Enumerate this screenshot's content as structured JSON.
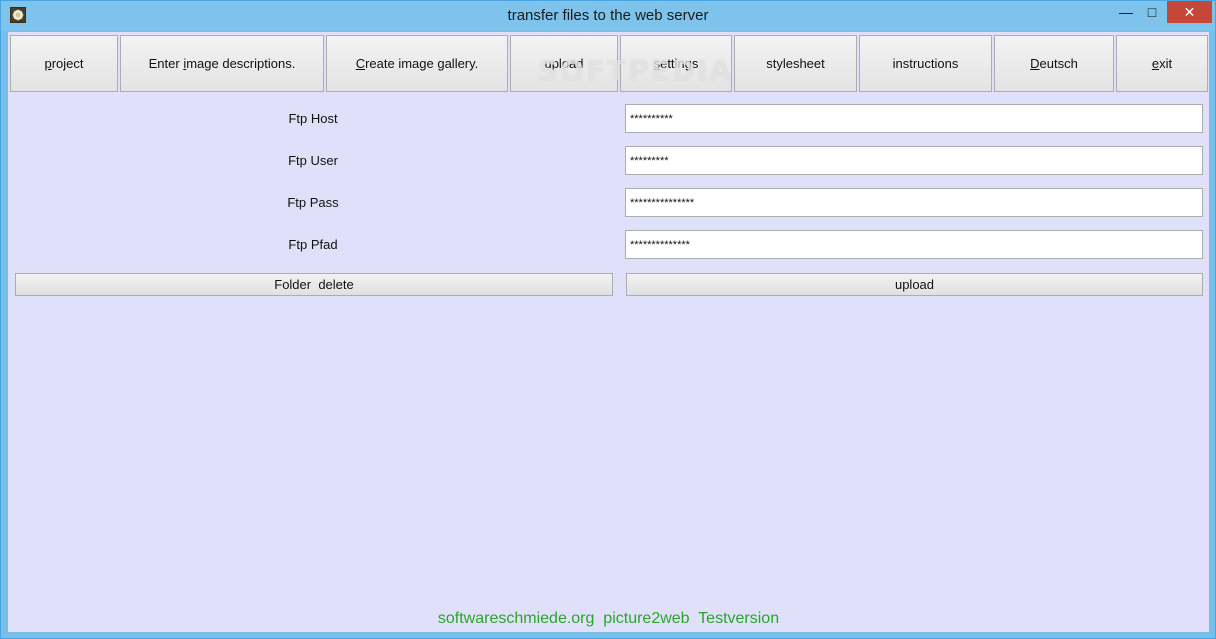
{
  "window": {
    "title": "transfer files to the web server",
    "minimize_glyph": "—",
    "maximize_glyph": "□",
    "close_glyph": "✕"
  },
  "toolbar": {
    "project": {
      "ul": "p",
      "rest": "roject"
    },
    "descriptions": {
      "pre": "Enter ",
      "ul": "i",
      "rest": "mage descriptions."
    },
    "gallery": {
      "ul": "C",
      "rest": "reate image gallery."
    },
    "upload": "upload",
    "settings": {
      "ul": "s",
      "rest": "ettings"
    },
    "stylesheet": "stylesheet",
    "instructions": "instructions",
    "deutsch": {
      "ul": "D",
      "rest": "eutsch"
    },
    "exit": {
      "ul": "e",
      "rest": "xit"
    }
  },
  "watermark": "SOFTPEDIA",
  "form": {
    "host_label": "Ftp Host",
    "host_value": "**********",
    "user_label": "Ftp User",
    "user_value": "*********",
    "pass_label": "Ftp Pass",
    "pass_value": "***************",
    "path_label": "Ftp Pfad",
    "path_value": "**************"
  },
  "actions": {
    "folder_delete": "Folder  delete",
    "upload": "upload"
  },
  "footer": "softwareschmiede.org  picture2web  Testversion",
  "colors": {
    "title_bar": "#7ec3ec",
    "client_bg": "#e1e0fa",
    "close_button": "#c7463a",
    "footer_text": "#2aa52a"
  }
}
